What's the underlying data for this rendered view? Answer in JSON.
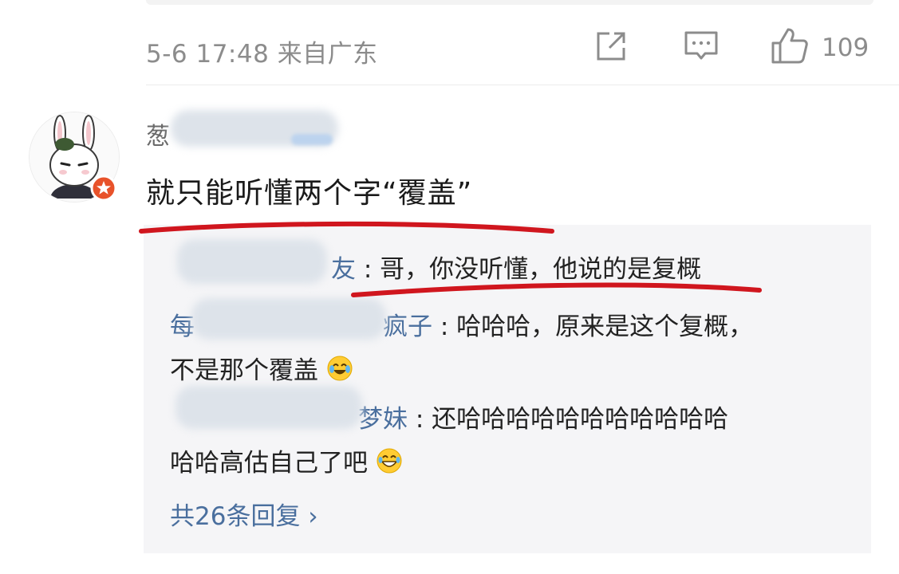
{
  "post_meta": {
    "time": "5-6 17:48",
    "source": "来自广东",
    "like_count": "109"
  },
  "comment": {
    "author_visible_prefix": "葱",
    "text": "就只能听懂两个字“覆盖”"
  },
  "replies": [
    {
      "name_start": "",
      "name_end": "友",
      "text": ": 哥，你没听懂，他说的是复概"
    },
    {
      "name_start": "每",
      "name_end": "疯子",
      "text": ": 哈哈哈，原来是这个复概，",
      "text_line2": "不是那个覆盖"
    },
    {
      "name_start": "",
      "name_end": "梦妹",
      "text": ": 还哈哈哈哈哈哈哈哈哈哈哈",
      "text_line2": "哈哈高估自己了吧"
    }
  ],
  "more_replies": "共26条回复 ›",
  "icons": [
    "share-icon",
    "comment-icon",
    "thumbs-up-icon",
    "laugh-cry-emoji",
    "grin-emoji",
    "vip-badge-icon"
  ],
  "colors": {
    "link_blue": "#4a6f9e",
    "meta_gray": "#8c8c8c",
    "marker_red": "#d0161e",
    "reply_bg": "#f5f5f7"
  }
}
